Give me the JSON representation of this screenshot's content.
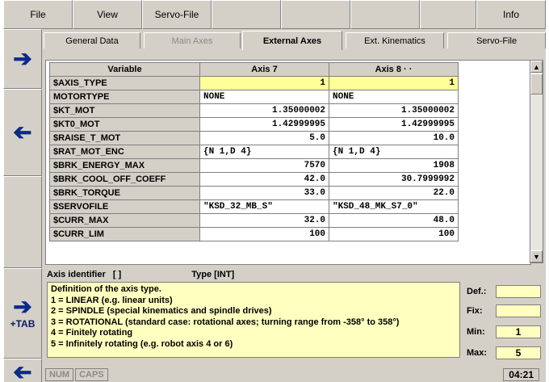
{
  "menu": [
    "File",
    "View",
    "Servo-File",
    "",
    "",
    "",
    "",
    "Info"
  ],
  "tabs": [
    {
      "label": "General Data",
      "state": "normal"
    },
    {
      "label": "Main Axes",
      "state": "disabled"
    },
    {
      "label": "External Axes",
      "state": "active"
    },
    {
      "label": "Ext. Kinematics",
      "state": "normal"
    },
    {
      "label": "Servo-File",
      "state": "normal"
    }
  ],
  "table": {
    "headers": [
      "Variable",
      "Axis 7",
      "Axis 8 ·  ·"
    ],
    "rows": [
      {
        "var": "$AXIS_TYPE",
        "a7": "1",
        "a8": "1",
        "align": "num",
        "yellow": true
      },
      {
        "var": "MOTORTYPE",
        "a7": "NONE",
        "a8": "NONE",
        "align": "left"
      },
      {
        "var": "$KT_MOT",
        "a7": "1.35000002",
        "a8": "1.35000002",
        "align": "num"
      },
      {
        "var": "$KT0_MOT",
        "a7": "1.42999995",
        "a8": "1.42999995",
        "align": "num"
      },
      {
        "var": "$RAISE_T_MOT",
        "a7": "5.0",
        "a8": "10.0",
        "align": "num"
      },
      {
        "var": "$RAT_MOT_ENC",
        "a7": "{N 1,D 4}",
        "a8": "{N 1,D 4}",
        "align": "left"
      },
      {
        "var": "$BRK_ENERGY_MAX",
        "a7": "7570",
        "a8": "1908",
        "align": "num"
      },
      {
        "var": "$BRK_COOL_OFF_COEFF",
        "a7": "42.0",
        "a8": "30.7999992",
        "align": "num"
      },
      {
        "var": "$BRK_TORQUE",
        "a7": "33.0",
        "a8": "22.0",
        "align": "num"
      },
      {
        "var": "$SERVOFILE",
        "a7": "\"KSD_32_MB_S\"",
        "a8": "\"KSD_48_MK_S7_0\"",
        "align": "left"
      },
      {
        "var": "$CURR_MAX",
        "a7": "32.0",
        "a8": "48.0",
        "align": "num"
      },
      {
        "var": "$CURR_LIM",
        "a7": "100",
        "a8": "100",
        "align": "num"
      }
    ]
  },
  "info": {
    "label": "Axis identifier",
    "brackets": "[ ]",
    "type": "Type [INT]",
    "lines": [
      "Definition of the axis type.",
      "1 = LINEAR (e.g. linear units)",
      "2 = SPINDLE (special kinematics and spindle drives)",
      "3 = ROTATIONAL (standard case: rotational axes; turning range from -358° to 358°)",
      "4 = Finitely rotating",
      "5 = Infinitely rotating (e.g. robot axis 4 or 6)"
    ]
  },
  "limits": {
    "def_label": "Def.:",
    "def_value": "",
    "fix_label": "Fix:",
    "fix_value": "",
    "min_label": "Min:",
    "min_value": "1",
    "max_label": "Max:",
    "max_value": "5"
  },
  "softkeys": {
    "tab_label": "+TAB"
  },
  "status": {
    "num": "NUM",
    "caps": "CAPS",
    "time": "04:21"
  },
  "icons": [
    "arrow-right-icon",
    "arrow-left-icon",
    "scroll-up-icon",
    "scroll-down-icon"
  ],
  "colors": {
    "arrow": "#0b2a8c",
    "highlight": "#ffff99",
    "help_bg": "#ffffc0"
  }
}
